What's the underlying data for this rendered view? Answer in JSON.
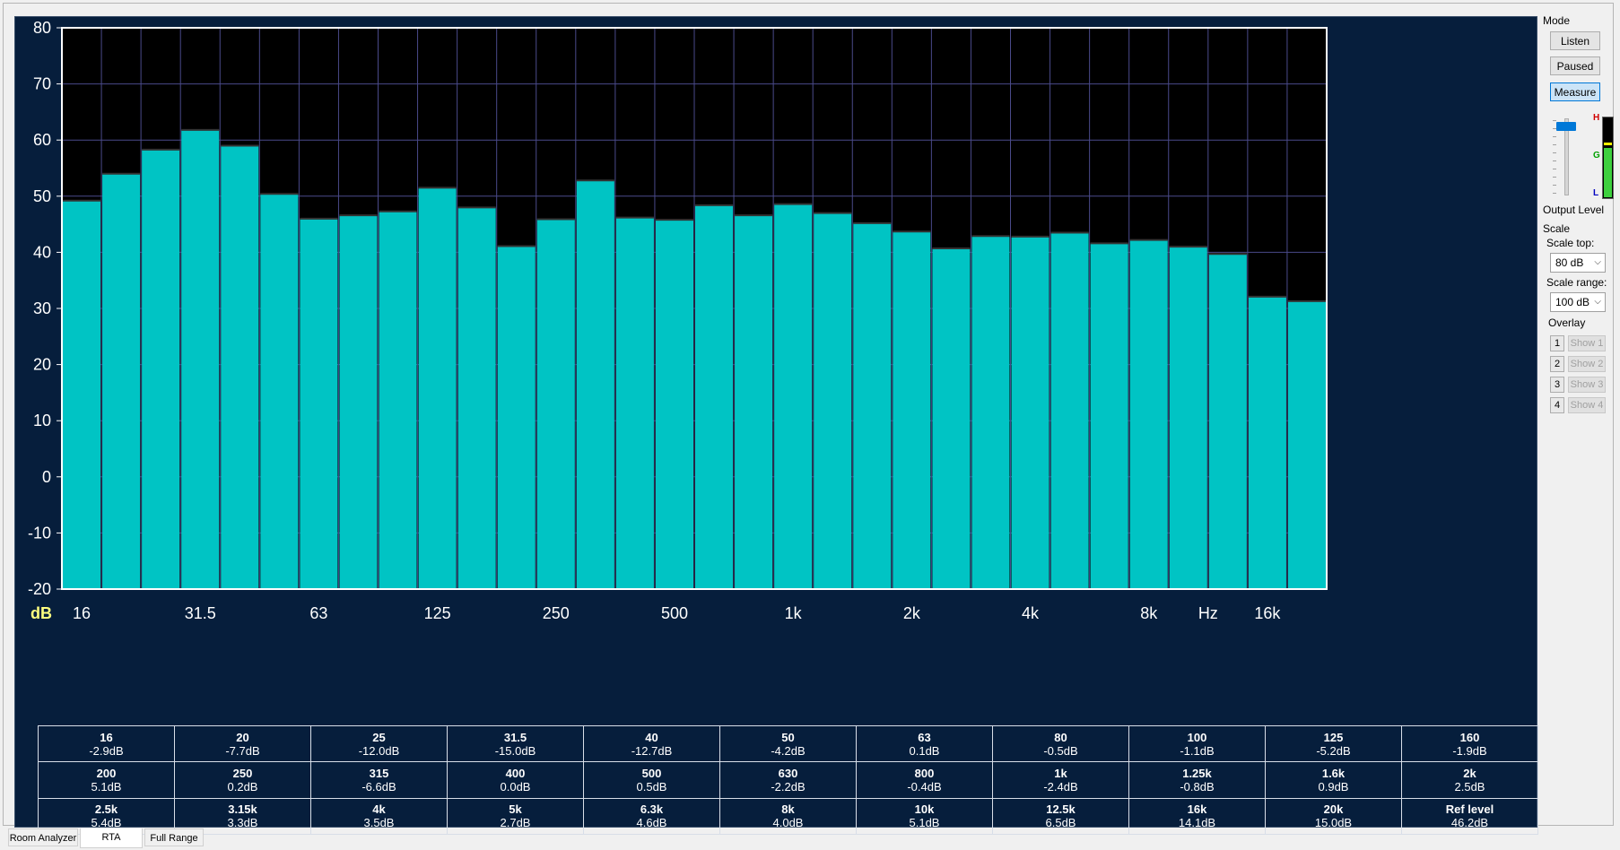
{
  "chart_data": {
    "type": "bar",
    "ylim": [
      -20,
      80
    ],
    "yticks": [
      "80",
      "70",
      "60",
      "50",
      "40",
      "30",
      "20",
      "10",
      "0",
      "-10",
      "-20"
    ],
    "y_unit_label": "dB",
    "x_unit_label": "Hz",
    "xticks": [
      {
        "label": "16",
        "band": 0
      },
      {
        "label": "31.5",
        "band": 3
      },
      {
        "label": "63",
        "band": 6
      },
      {
        "label": "125",
        "band": 9
      },
      {
        "label": "250",
        "band": 12
      },
      {
        "label": "500",
        "band": 15
      },
      {
        "label": "1k",
        "band": 18
      },
      {
        "label": "2k",
        "band": 21
      },
      {
        "label": "4k",
        "band": 24
      },
      {
        "label": "8k",
        "band": 27
      },
      {
        "label": "16k",
        "band": 30
      }
    ],
    "categories": [
      "16",
      "20",
      "25",
      "31.5",
      "40",
      "50",
      "63",
      "80",
      "100",
      "125",
      "160",
      "200",
      "250",
      "315",
      "400",
      "500",
      "630",
      "800",
      "1k",
      "1.25k",
      "1.6k",
      "2k",
      "2.5k",
      "3.15k",
      "4k",
      "5k",
      "6.3k",
      "8k",
      "10k",
      "12.5k",
      "16k",
      "20k"
    ],
    "values": [
      49.2,
      54.0,
      58.3,
      61.8,
      59.0,
      50.4,
      46.0,
      46.6,
      47.3,
      51.5,
      48.0,
      41.1,
      45.9,
      52.8,
      46.2,
      45.8,
      48.4,
      46.6,
      48.6,
      47.0,
      45.2,
      43.7,
      40.7,
      42.9,
      42.8,
      43.5,
      41.6,
      42.2,
      41.0,
      39.7,
      32.1,
      31.3
    ],
    "grid": true,
    "bar_color": "#00c4c4"
  },
  "table_rows": [
    [
      {
        "band": "16",
        "value": "-2.9dB"
      },
      {
        "band": "20",
        "value": "-7.7dB"
      },
      {
        "band": "25",
        "value": "-12.0dB"
      },
      {
        "band": "31.5",
        "value": "-15.0dB"
      },
      {
        "band": "40",
        "value": "-12.7dB"
      },
      {
        "band": "50",
        "value": "-4.2dB"
      },
      {
        "band": "63",
        "value": "0.1dB"
      },
      {
        "band": "80",
        "value": "-0.5dB"
      },
      {
        "band": "100",
        "value": "-1.1dB"
      },
      {
        "band": "125",
        "value": "-5.2dB"
      },
      {
        "band": "160",
        "value": "-1.9dB"
      }
    ],
    [
      {
        "band": "200",
        "value": "5.1dB"
      },
      {
        "band": "250",
        "value": "0.2dB"
      },
      {
        "band": "315",
        "value": "-6.6dB"
      },
      {
        "band": "400",
        "value": "0.0dB"
      },
      {
        "band": "500",
        "value": "0.5dB"
      },
      {
        "band": "630",
        "value": "-2.2dB"
      },
      {
        "band": "800",
        "value": "-0.4dB"
      },
      {
        "band": "1k",
        "value": "-2.4dB"
      },
      {
        "band": "1.25k",
        "value": "-0.8dB"
      },
      {
        "band": "1.6k",
        "value": "0.9dB"
      },
      {
        "band": "2k",
        "value": "2.5dB"
      }
    ],
    [
      {
        "band": "2.5k",
        "value": "5.4dB"
      },
      {
        "band": "3.15k",
        "value": "3.3dB"
      },
      {
        "band": "4k",
        "value": "3.5dB"
      },
      {
        "band": "5k",
        "value": "2.7dB"
      },
      {
        "band": "6.3k",
        "value": "4.6dB"
      },
      {
        "band": "8k",
        "value": "4.0dB"
      },
      {
        "band": "10k",
        "value": "5.1dB"
      },
      {
        "band": "12.5k",
        "value": "6.5dB"
      },
      {
        "band": "16k",
        "value": "14.1dB"
      },
      {
        "band": "20k",
        "value": "15.0dB"
      },
      {
        "band": "Ref level",
        "value": "46.2dB"
      }
    ]
  ],
  "side": {
    "mode_title": "Mode",
    "listen_label": "Listen",
    "paused_label": "Paused",
    "measure_label": "Measure",
    "meter_h": "H",
    "meter_g": "G",
    "meter_l": "L",
    "output_level_label": "Output Level",
    "output_level_fraction": 0.93,
    "meter_level_fraction": 0.62,
    "scale_title": "Scale",
    "scale_top_label": "Scale top:",
    "scale_top_value": "80 dB",
    "scale_range_label": "Scale range:",
    "scale_range_value": "100 dB",
    "overlay_title": "Overlay",
    "overlays": [
      {
        "num": "1",
        "show": "Show 1"
      },
      {
        "num": "2",
        "show": "Show 2"
      },
      {
        "num": "3",
        "show": "Show 3"
      },
      {
        "num": "4",
        "show": "Show 4"
      }
    ]
  },
  "tabs": [
    {
      "label": "Room Analyzer",
      "active": false
    },
    {
      "label": "RTA",
      "active": true
    },
    {
      "label": "Full Range",
      "active": false
    }
  ]
}
